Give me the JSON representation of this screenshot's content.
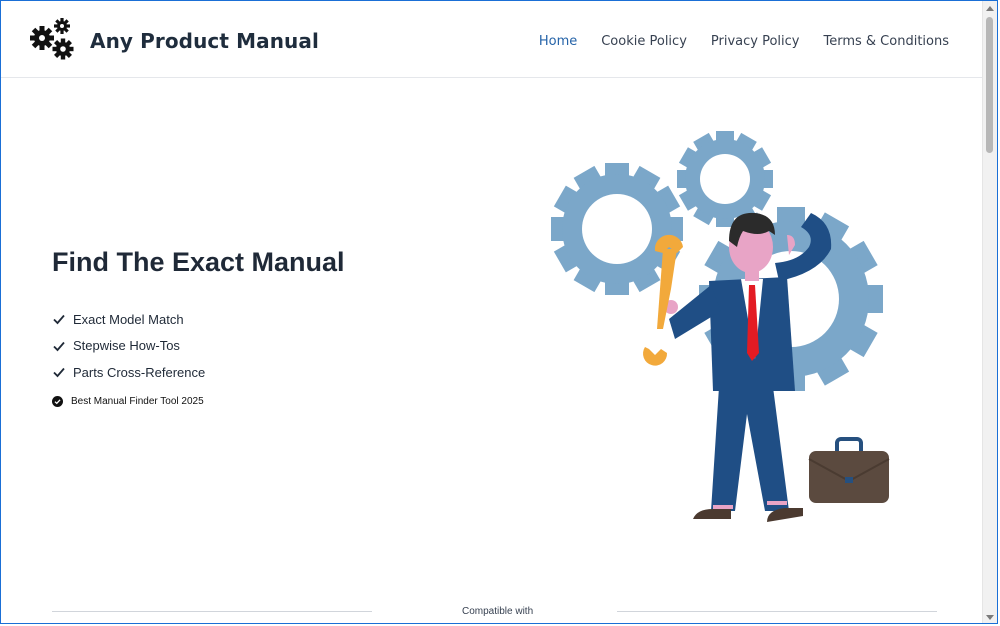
{
  "header": {
    "brand": "Any Product Manual",
    "logo_icon": "gears-icon",
    "nav": [
      {
        "label": "Home",
        "active": true
      },
      {
        "label": "Cookie Policy"
      },
      {
        "label": "Privacy Policy"
      },
      {
        "label": "Terms & Conditions"
      }
    ]
  },
  "hero": {
    "title": "Find The Exact Manual",
    "features": [
      "Exact Model Match",
      "Stepwise How-Tos",
      "Parts Cross-Reference"
    ],
    "badge": "Best Manual Finder Tool 2025",
    "illustration": "man-with-wrench-and-gears-illustration"
  },
  "compat": {
    "label": "Compatible with"
  },
  "colors": {
    "accent": "#2563a8",
    "gear": "#7ba7c9",
    "wrench": "#f2a93b",
    "suit": "#1f4e85",
    "tie": "#e31b23",
    "briefcase": "#5b4a3f",
    "frame_border": "#1a6fd6"
  }
}
